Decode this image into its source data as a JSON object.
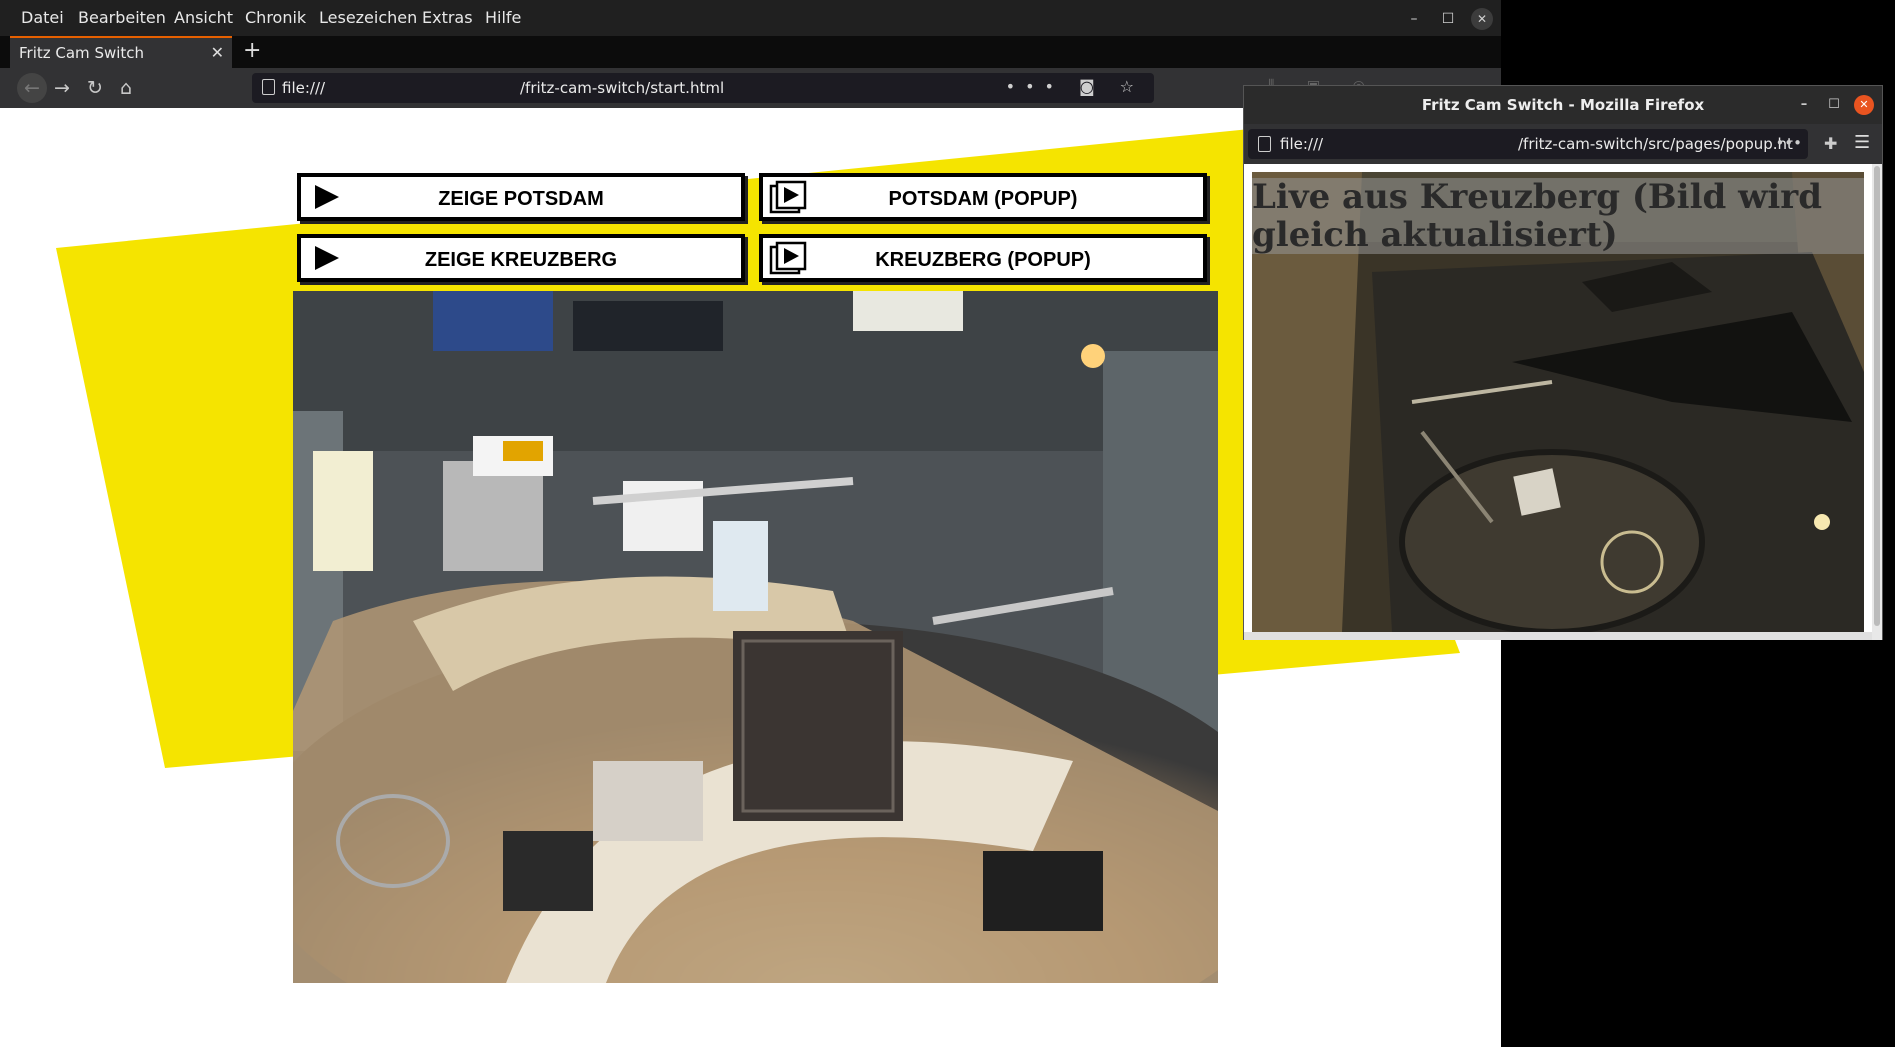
{
  "main_window": {
    "menu": [
      "Datei",
      "Bearbeiten",
      "Ansicht",
      "Chronik",
      "Lesezeichen",
      "Extras",
      "Hilfe"
    ],
    "tab_title": "Fritz Cam Switch",
    "url_scheme": "file:///",
    "url_path": "/fritz-cam-switch/start.html",
    "window_controls": {
      "minimize": "–",
      "maximize": "☐",
      "close": "✕"
    }
  },
  "page": {
    "accent_color": "#f5e400",
    "buttons": {
      "show_potsdam": "ZEIGE POTSDAM",
      "potsdam_popup": "POTSDAM (POPUP)",
      "show_kreuzberg": "ZEIGE KREUZBERG",
      "kreuzberg_popup": "KREUZBERG (POPUP)"
    }
  },
  "popup_window": {
    "title": "Fritz Cam Switch - Mozilla Firefox",
    "url_scheme": "file:///",
    "url_path": "/fritz-cam-switch/src/pages/popup.ht",
    "caption": "Live aus Kreuzberg (Bild wird gleich aktualisiert)"
  }
}
